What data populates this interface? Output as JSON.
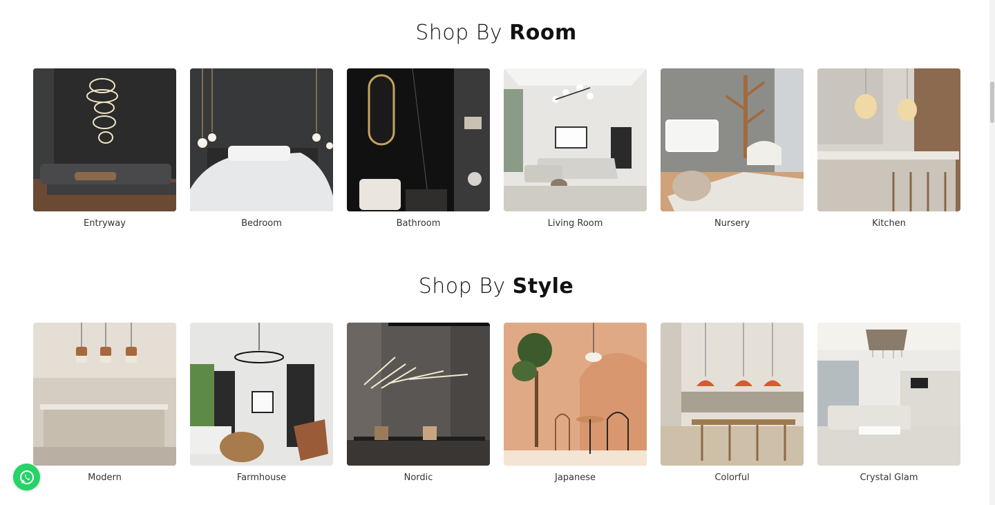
{
  "sections": {
    "room": {
      "title_light": "Shop By",
      "title_bold": "Room",
      "items": [
        {
          "label": "Entryway",
          "image": "dark-living-room-with-ring-chandelier"
        },
        {
          "label": "Bedroom",
          "image": "dark-bedroom-white-bedding"
        },
        {
          "label": "Bathroom",
          "image": "black-marble-bathroom-oval-mirror"
        },
        {
          "label": "Living Room",
          "image": "bright-living-room-sputnik-light"
        },
        {
          "label": "Nursery",
          "image": "nursery-crib-tree-shelf"
        },
        {
          "label": "Kitchen",
          "image": "marble-kitchen-island-pendants"
        }
      ]
    },
    "style": {
      "title_light": "Shop By",
      "title_bold": "Style",
      "items": [
        {
          "label": "Modern",
          "image": "beige-kitchen-copper-pendants"
        },
        {
          "label": "Farmhouse",
          "image": "farmhouse-living-room-wagon-chandelier"
        },
        {
          "label": "Nordic",
          "image": "nordic-dining-linear-chandelier"
        },
        {
          "label": "Japanese",
          "image": "peach-wall-bistro-table"
        },
        {
          "label": "Colorful",
          "image": "cafe-dining-orange-pendants"
        },
        {
          "label": "Crystal Glam",
          "image": "glam-living-room-crystal-chandelier"
        }
      ]
    }
  },
  "whatsapp": {
    "icon": "whatsapp-icon",
    "color": "#25d366"
  }
}
